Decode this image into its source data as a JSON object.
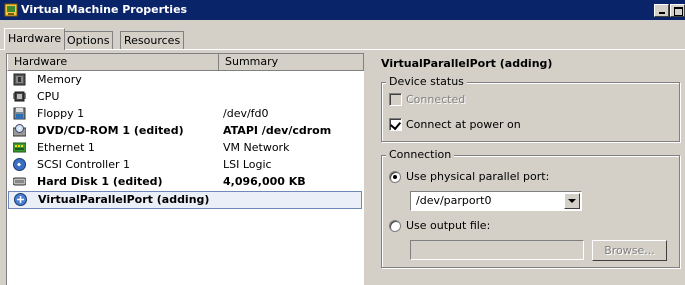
{
  "window": {
    "title": "Virtual Machine Properties",
    "colors": {
      "titlebar": "#0a246a",
      "selection_bg": "#ebeff7",
      "selection_border": "#6f89b8"
    }
  },
  "tabs": [
    {
      "label": "Hardware",
      "active": true
    },
    {
      "label": "Options",
      "active": false
    },
    {
      "label": "Resources",
      "active": false
    }
  ],
  "hardware_list": {
    "columns": [
      "Hardware",
      "Summary"
    ],
    "rows": [
      {
        "name": "Memory",
        "summary": "",
        "icon": "memory-icon",
        "bold": false
      },
      {
        "name": "CPU",
        "summary": "",
        "icon": "cpu-icon",
        "bold": false
      },
      {
        "name": "Floppy 1",
        "summary": "/dev/fd0",
        "icon": "floppy-icon",
        "bold": false
      },
      {
        "name": "DVD/CD-ROM 1 (edited)",
        "summary": "ATAPI /dev/cdrom",
        "icon": "cdrom-icon",
        "bold": true
      },
      {
        "name": "Ethernet 1",
        "summary": "VM Network",
        "icon": "network-icon",
        "bold": false
      },
      {
        "name": "SCSI Controller 1",
        "summary": "LSI Logic",
        "icon": "scsi-icon",
        "bold": false
      },
      {
        "name": "Hard Disk 1 (edited)",
        "summary": "4,096,000 KB",
        "icon": "harddisk-icon",
        "bold": true
      },
      {
        "name": "VirtualParallelPort (adding)",
        "summary": "",
        "icon": "parallel-port-icon",
        "bold": true,
        "selected": true
      }
    ]
  },
  "details": {
    "title": "VirtualParallelPort (adding)",
    "device_status": {
      "label": "Device status",
      "connected": {
        "label": "Connected",
        "checked": false,
        "disabled": true
      },
      "power_on": {
        "label": "Connect at power on",
        "checked": true
      }
    },
    "connection": {
      "label": "Connection",
      "physical": {
        "label": "Use physical parallel port:",
        "selected": true
      },
      "port_value": "/dev/parport0",
      "output": {
        "label": "Use output file:",
        "selected": false
      },
      "output_value": "",
      "browse_label": "Browse..."
    }
  }
}
